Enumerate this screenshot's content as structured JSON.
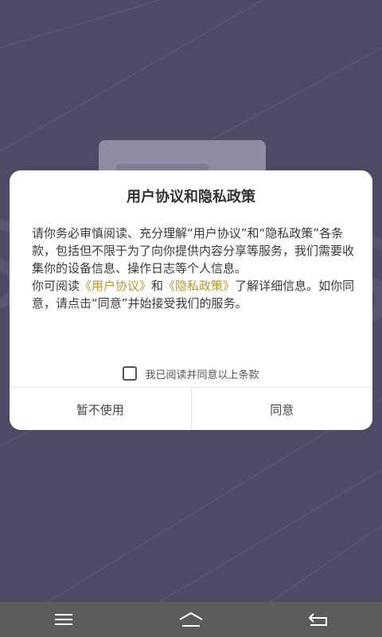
{
  "dialog": {
    "title": "用户协议和隐私政策",
    "paragraph1": "请你务必审慎阅读、充分理解“用户协议”和“隐私政策”各条款，包括但不限于为了向你提供内容分享等服务，我们需要收集你的设备信息、操作日志等个人信息。",
    "paragraph2_prefix": "你可阅读",
    "user_agreement_link": "《用户协议》",
    "paragraph2_and": "和",
    "privacy_policy_link": "《隐私政策》",
    "paragraph2_suffix": "了解详细信息。如你同意，请点击“同意”并始接受我们的服务。",
    "checkbox_label": "我已阅读并同意以上条款",
    "checkbox_checked": false,
    "decline_label": "暂不使用",
    "agree_label": "同意"
  },
  "colors": {
    "background": "#4e4a66",
    "link": "#b8952f",
    "navbar": "#5c5c5c"
  },
  "navbar": {
    "icons": [
      "menu-icon",
      "home-icon",
      "back-icon"
    ]
  }
}
